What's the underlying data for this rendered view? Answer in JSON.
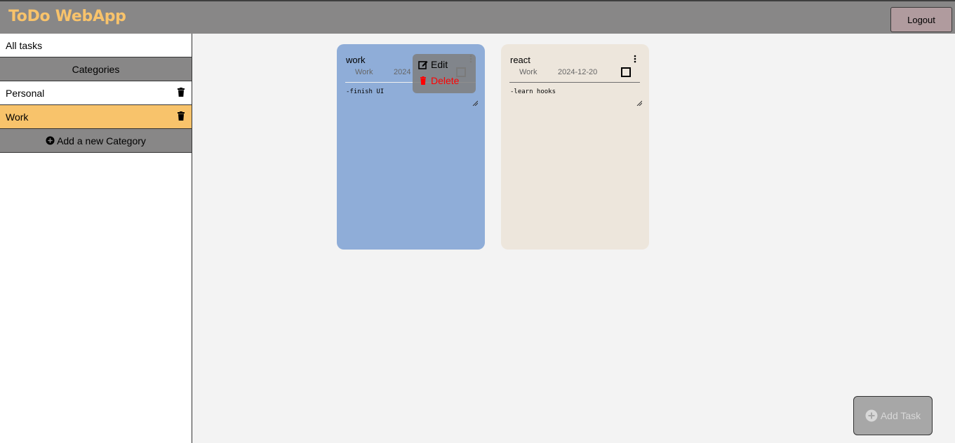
{
  "header": {
    "app_title": "ToDo WebApp",
    "logout_label": "Logout"
  },
  "sidebar": {
    "all_tasks_label": "All tasks",
    "categories_header": "Categories",
    "categories": [
      {
        "label": "Personal",
        "active": false
      },
      {
        "label": "Work",
        "active": true
      }
    ],
    "add_category_label": "Add a new Category"
  },
  "tasks": [
    {
      "title": "work",
      "category": "Work",
      "date": "2024",
      "note": "-finish UI",
      "color": "#8fadd8",
      "done": false
    },
    {
      "title": "react",
      "category": "Work",
      "date": "2024-12-20",
      "note": "-learn hooks",
      "color": "#ede6dc",
      "done": false
    }
  ],
  "context_menu": {
    "edit_label": "Edit",
    "delete_label": "Delete",
    "delete_color": "#ff0000"
  },
  "add_task_label": "Add Task",
  "colors": {
    "accent": "#f8c36b",
    "header_bg": "#888787",
    "logout_bg": "#b09b9e"
  }
}
